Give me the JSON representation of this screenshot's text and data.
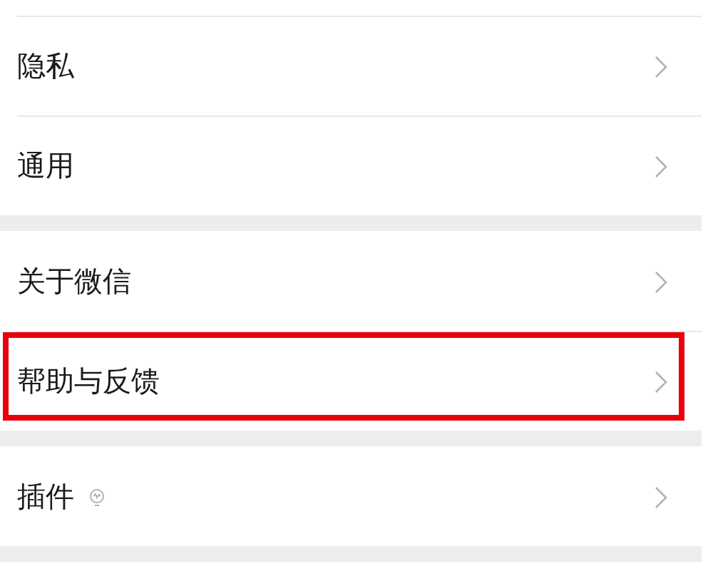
{
  "groups": [
    {
      "items": [
        {
          "label": "隐私",
          "kind": "plain",
          "highlighted": false
        },
        {
          "label": "通用",
          "kind": "plain",
          "highlighted": false
        }
      ]
    },
    {
      "items": [
        {
          "label": "关于微信",
          "kind": "plain",
          "highlighted": false
        },
        {
          "label": "帮助与反馈",
          "kind": "plain",
          "highlighted": true
        }
      ]
    },
    {
      "items": [
        {
          "label": "插件",
          "kind": "with-icon",
          "highlighted": false
        }
      ]
    }
  ]
}
